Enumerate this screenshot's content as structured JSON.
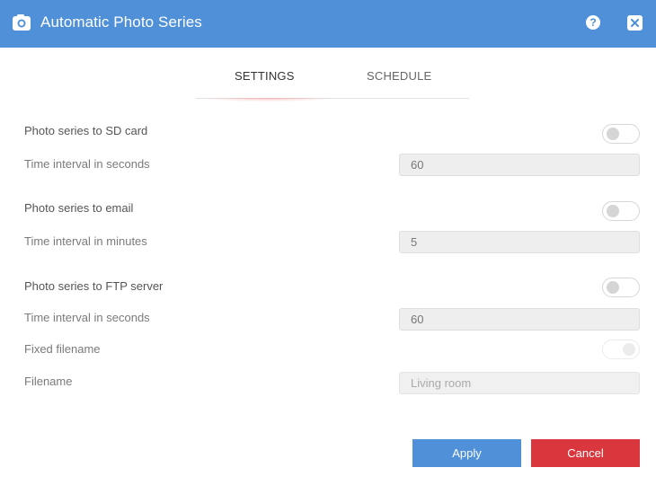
{
  "window": {
    "title": "Automatic Photo Series",
    "title_icon": "camera-icon",
    "help_label": "?",
    "help_icon": "help-icon",
    "close_icon": "close-icon",
    "accent_color": "#4f90d9",
    "danger_color": "#d9363e"
  },
  "tabs": [
    {
      "label": "SETTINGS",
      "active": true
    },
    {
      "label": "SCHEDULE",
      "active": false
    }
  ],
  "sd_card": {
    "label": "Photo series to SD card",
    "enabled": false,
    "interval_label": "Time interval in seconds",
    "interval_value": "60"
  },
  "email": {
    "label": "Photo series to email",
    "enabled": false,
    "interval_label": "Time interval in minutes",
    "interval_value": "5"
  },
  "ftp": {
    "label": "Photo series to FTP server",
    "enabled": false,
    "interval_label": "Time interval in seconds",
    "interval_value": "60",
    "fixed_filename_label": "Fixed filename",
    "fixed_filename_enabled": false,
    "filename_label": "Filename",
    "filename_placeholder": "Living room"
  },
  "buttons": {
    "apply": "Apply",
    "cancel": "Cancel"
  }
}
